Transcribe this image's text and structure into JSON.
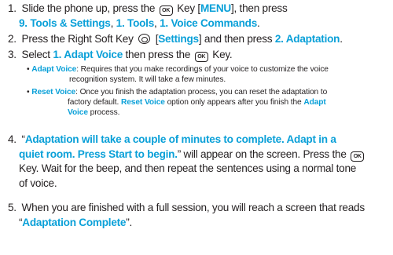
{
  "steps": {
    "s1": {
      "num": "1.",
      "a": "Slide the phone up, press the",
      "ok_icon": "ok-key-icon",
      "b": "Key [",
      "menu": "MENU",
      "c": "], then press",
      "d": "9. Tools & Settings",
      "e": ",",
      "f": "1. Tools",
      "g": ",",
      "h": "1. Voice Commands",
      "i": "."
    },
    "s2": {
      "num": "2.",
      "a": "Press the Right Soft Key",
      "soft_icon": "right-soft-key-icon",
      "b": "[",
      "c": "Settings",
      "d": "] and then press",
      "e": "2. Adaptation",
      "f": "."
    },
    "s3": {
      "num": "3.",
      "a": "Select",
      "b": "1. Adapt Voice",
      "c": "then press the",
      "d": "Key."
    },
    "b1": {
      "bullet": "•",
      "label": "Adapt Voice",
      "l1": ": Requires that you make recordings of your voice to customize the voice",
      "l2": "recognition system. It will take a few minutes."
    },
    "b2": {
      "bullet": "•",
      "label": "Reset Voice",
      "l1": ": Once you finish the adaptation process, you can reset the adaptation to",
      "l2a": "factory default.",
      "l2b": "Reset Voice",
      "l2c": "option only appears after you finish the",
      "l2d": "Adapt",
      "l3a": "Voice",
      "l3b": "process."
    },
    "s4": {
      "num": "4.",
      "q1": "“",
      "l1": "Adaptation will take a couple of minutes to complete. Adapt in a",
      "l2": "quiet room. Press Start to begin.",
      "q2": "” will appear on the screen. Press the",
      "l3": "Key. Wait for the beep, and then repeat the sentences using a normal tone",
      "l4": "of voice."
    },
    "s5": {
      "num": "5.",
      "l1": "When you are finished with a full session, you will reach a screen that reads",
      "q1": "“",
      "l2": "Adaptation Complete",
      "q2": "”."
    }
  },
  "colors": {
    "highlight": "#0aa0d8",
    "text": "#231f20"
  }
}
